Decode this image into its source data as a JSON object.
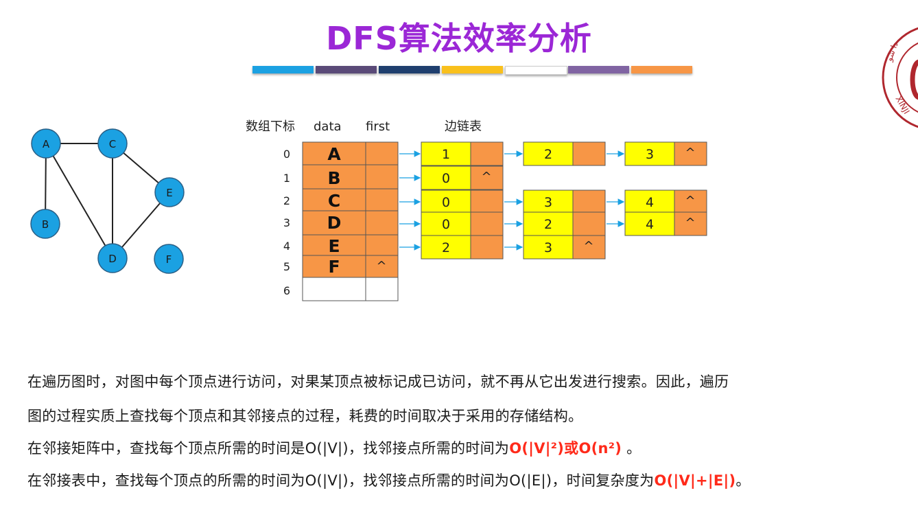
{
  "title": "DFS算法效率分析",
  "color_strip": [
    "#1ba1e2",
    "#5a4a78",
    "#1f3f6e",
    "#f9c01c",
    "#ffffff",
    "#8064a2",
    "#f79646"
  ],
  "logo": {
    "arc_text": "XINJI",
    "script_text": "دا شو",
    "border_color": "#b0272e"
  },
  "graph": {
    "node_fill": "#1ba1e2",
    "nodes": [
      {
        "id": "A",
        "label": "A"
      },
      {
        "id": "C",
        "label": "C"
      },
      {
        "id": "E",
        "label": "E"
      },
      {
        "id": "B",
        "label": "B"
      },
      {
        "id": "D",
        "label": "D"
      },
      {
        "id": "F",
        "label": "F"
      }
    ],
    "edges": [
      [
        "A",
        "C"
      ],
      [
        "A",
        "B"
      ],
      [
        "A",
        "D"
      ],
      [
        "C",
        "D"
      ],
      [
        "C",
        "E"
      ],
      [
        "D",
        "E"
      ]
    ]
  },
  "table": {
    "header_index": "数组下标",
    "header_data": "data",
    "header_first": "first",
    "header_edges": "边链表",
    "null_marker": "^",
    "cell_fill": "#f79646",
    "node_fill": "#ffff00",
    "rows": [
      {
        "index": "0",
        "data": "A",
        "first_null": false,
        "chain": [
          {
            "v": "1"
          },
          {
            "v": "2"
          },
          {
            "v": "3"
          }
        ]
      },
      {
        "index": "1",
        "data": "B",
        "first_null": false,
        "chain": [
          {
            "v": "0"
          }
        ]
      },
      {
        "index": "2",
        "data": "C",
        "first_null": false,
        "chain": [
          {
            "v": "0"
          },
          {
            "v": "3"
          },
          {
            "v": "4"
          }
        ]
      },
      {
        "index": "3",
        "data": "D",
        "first_null": false,
        "chain": [
          {
            "v": "0"
          },
          {
            "v": "2"
          },
          {
            "v": "4"
          }
        ]
      },
      {
        "index": "4",
        "data": "E",
        "first_null": false,
        "chain": [
          {
            "v": "2"
          },
          {
            "v": "3"
          }
        ]
      },
      {
        "index": "5",
        "data": "F",
        "first_null": true,
        "chain": []
      },
      {
        "index": "6",
        "data": "",
        "first_null": false,
        "chain": [],
        "empty": true
      }
    ]
  },
  "text": {
    "line1": "在遍历图时，对图中每个顶点进行访问，对果某顶点被标记成已访问，就不再从它出发进行搜索。因此，遍历",
    "line2": "图的过程实质上查找每个顶点和其邻接点的过程，耗费的时间取决于采用的存储结构。",
    "line3_a": "在邻接矩阵中，查找每个顶点所需的时间是O(|V|)，找邻接点所需的时间为",
    "line3_hl": "O(|V|²)或O(n²)",
    "line3_b": " 。",
    "line4_a": "在邻接表中，查找每个顶点的所需的时间为O(|V|)，找邻接点所需的时间为O(|E|)，时间复杂度为",
    "line4_hl": "O(|V|+|E|)",
    "line4_b": "。"
  }
}
